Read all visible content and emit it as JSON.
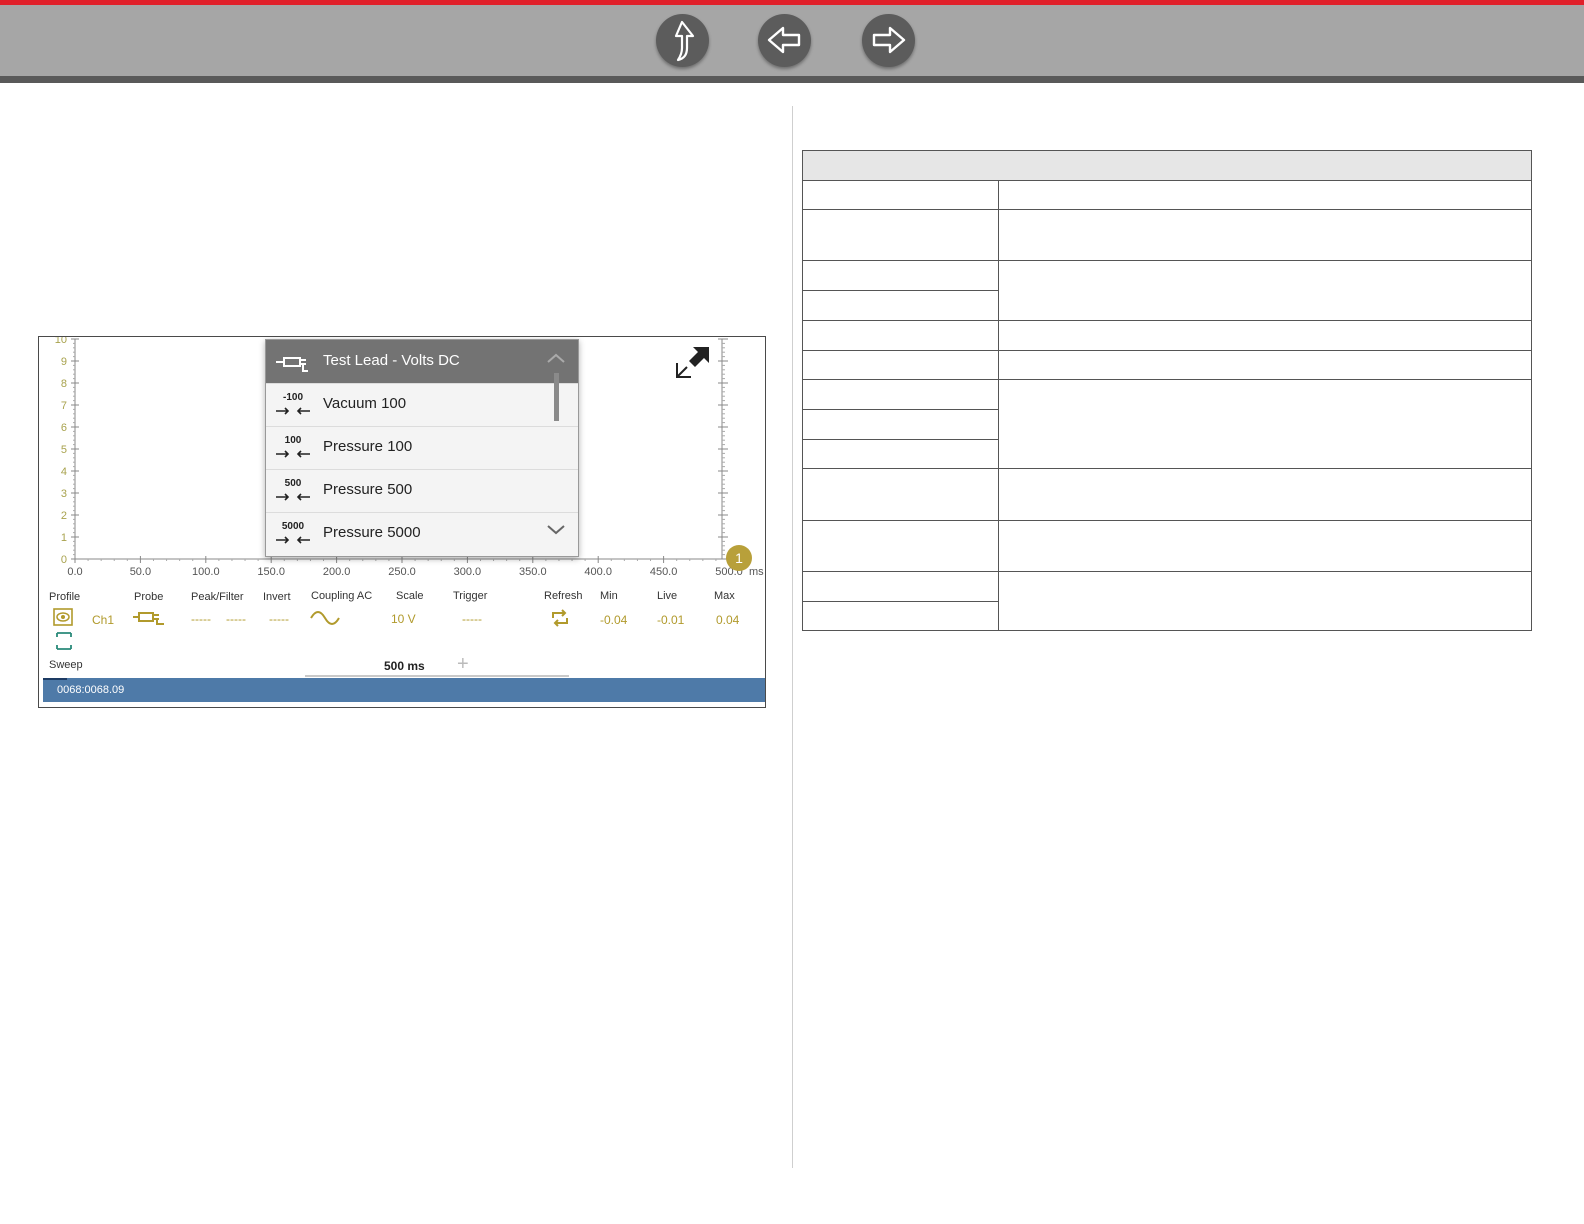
{
  "nav": {
    "up_label": "Up",
    "back_label": "Back",
    "forward_label": "Forward"
  },
  "scope": {
    "y_ticks": [
      "10",
      "9",
      "8",
      "7",
      "6",
      "5",
      "4",
      "3",
      "2",
      "1",
      "0"
    ],
    "x_ticks": [
      "0.0",
      "50.0",
      "100.0",
      "150.0",
      "200.0",
      "250.0",
      "300.0",
      "350.0",
      "400.0",
      "450.0",
      "500.0"
    ],
    "x_unit": "ms",
    "marker_label": "1"
  },
  "probe_menu": {
    "items": [
      {
        "label": "Test Lead - Volts DC",
        "icon": "test-lead-icon",
        "selected": true
      },
      {
        "label": "Vacuum 100",
        "icon": "vacuum-icon",
        "icon_text": "-100"
      },
      {
        "label": "Pressure 100",
        "icon": "pressure-icon",
        "icon_text": "100"
      },
      {
        "label": "Pressure 500",
        "icon": "pressure-icon",
        "icon_text": "500"
      },
      {
        "label": "Pressure 5000",
        "icon": "pressure-icon",
        "icon_text": "5000"
      }
    ]
  },
  "controls": {
    "headers": {
      "profile": "Profile",
      "probe": "Probe",
      "peak_filter": "Peak/Filter",
      "invert": "Invert",
      "coupling": "Coupling AC",
      "scale": "Scale",
      "trigger": "Trigger",
      "refresh": "Refresh",
      "min": "Min",
      "live": "Live",
      "max": "Max"
    },
    "values": {
      "channel": "Ch1",
      "peak": "-----",
      "filter": "-----",
      "invert": "-----",
      "scale": "10 V",
      "trigger": "-----",
      "min": "-0.04",
      "live": "-0.01",
      "max": "0.04"
    },
    "sweep_label": "Sweep",
    "sweep_value": "500 ms"
  },
  "status": {
    "text": "0068:0068.09"
  },
  "colors": {
    "accent": "#b19a2c",
    "status_bar": "#4e7aa8",
    "top_stripe": "#e0202a"
  }
}
